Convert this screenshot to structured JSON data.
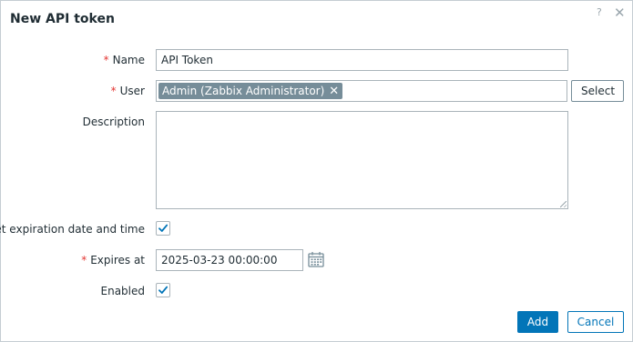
{
  "dialog": {
    "title": "New API token",
    "help_icon": "question-mark-icon",
    "close_icon": "close-icon"
  },
  "form": {
    "name": {
      "label": "Name",
      "value": "API Token",
      "required": true
    },
    "user": {
      "label": "User",
      "required": true,
      "selected_tag": "Admin (Zabbix Administrator)",
      "remove_glyph": "✕",
      "select_button": "Select"
    },
    "description": {
      "label": "Description",
      "value": ""
    },
    "set_expiration": {
      "label": "Set expiration date and time",
      "checked": true
    },
    "expires_at": {
      "label": "Expires at",
      "value": "2025-03-23 00:00:00",
      "required": true,
      "icon": "calendar-icon"
    },
    "enabled": {
      "label": "Enabled",
      "checked": true
    },
    "required_marker": "*"
  },
  "footer": {
    "add_button": "Add",
    "cancel_button": "Cancel"
  },
  "colors": {
    "primary": "#0275b8",
    "required": "#e33734",
    "tag_bg": "#768d99",
    "border": "#aab4ba"
  }
}
